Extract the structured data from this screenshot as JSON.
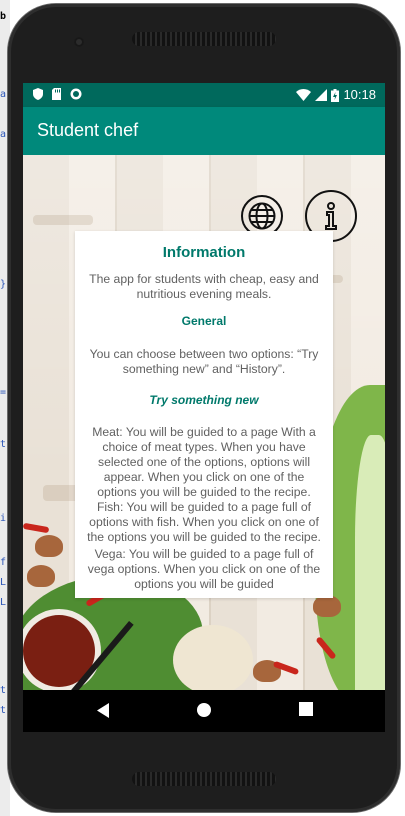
{
  "status_bar": {
    "time": "10:18",
    "left_icons": [
      "shield-icon",
      "sd-card-icon",
      "circle-icon"
    ],
    "right_icons": [
      "wifi-icon",
      "signal-icon",
      "battery-icon"
    ],
    "color": "#00695c"
  },
  "app_bar": {
    "title": "Student chef",
    "color": "#00897b"
  },
  "toolbar_icons": [
    "globe-icon",
    "info-icon"
  ],
  "info_card": {
    "title": "Information",
    "intro": "The app for students with  cheap, easy and nutritious evening meals.",
    "general_heading": "General",
    "general_text": "You can choose between two options: “Try something new” and “History”.",
    "try_heading": "Try something new",
    "meat_text": "Meat: You will be guided to a page With a choice of meat types. When you have selected one of the options, options will appear. When you click on one of the options you will be guided to the recipe.",
    "fish_text": "Fish: You will be guided to a page full of options with fish. When you click on one of the options you will be guided to the recipe.",
    "vega_text": "Vega: You will be guided to a page full of vega options. When you click on one of the options you will be guided"
  },
  "nav_bar": {
    "buttons": [
      "back-icon",
      "home-icon",
      "recents-icon"
    ]
  },
  "accent_color": "#00796b"
}
